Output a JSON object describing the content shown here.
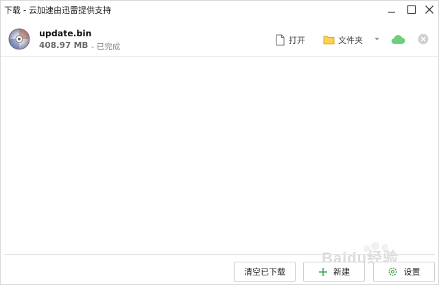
{
  "window": {
    "title": "下载 - 云加速由迅雷提供支持"
  },
  "download": {
    "file_name": "update.bin",
    "file_size": "408.97 MB",
    "status": "- 已完成",
    "actions": {
      "open_label": "打开",
      "folder_label": "文件夹"
    },
    "icons": {
      "file": "disc-icon",
      "open": "document-icon",
      "folder": "folder-icon",
      "dropdown": "caret-down-icon",
      "cloud": "cloud-icon",
      "remove": "close-circle-icon"
    }
  },
  "footer": {
    "clear_label": "清空已下载",
    "new_label": "新建",
    "settings_label": "设置"
  },
  "watermark": {
    "text": "Baidu经验"
  },
  "colors": {
    "folder": "#ffd24d",
    "cloud": "#6ccf7e",
    "new_plus": "#3aa84a",
    "settings_gear": "#3aa84a"
  }
}
